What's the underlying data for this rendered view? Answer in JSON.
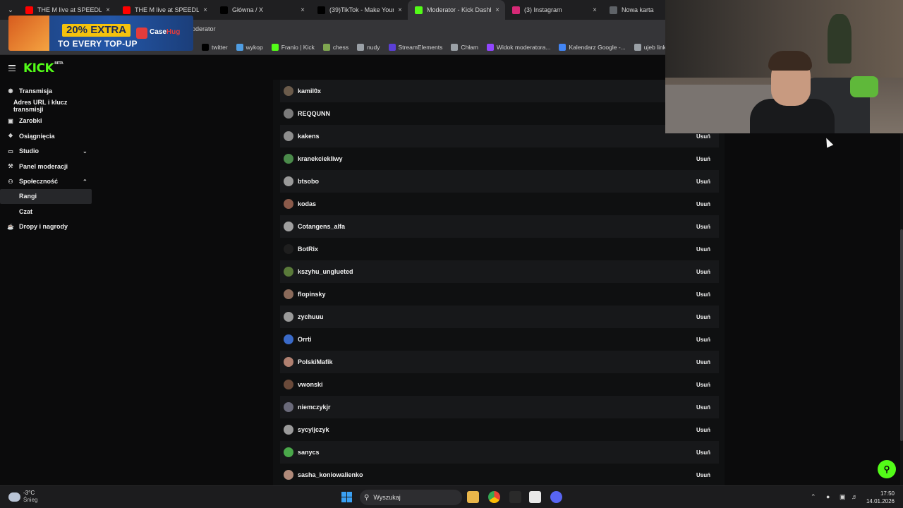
{
  "browser": {
    "tabs": [
      {
        "title": "THE M live at SPEEDLAND",
        "icon": "youtube-icon",
        "color": "#ff0000"
      },
      {
        "title": "THE M live at SPEEDLAND",
        "icon": "youtube-icon",
        "color": "#ff0000"
      },
      {
        "title": "Główna / X",
        "icon": "x-icon",
        "color": "#000000"
      },
      {
        "title": "(39)TikTok - Make Your Day",
        "icon": "tiktok-icon",
        "color": "#000000"
      },
      {
        "title": "Moderator - Kick Dashboard",
        "icon": "kick-icon",
        "color": "#53fc18",
        "active": true
      },
      {
        "title": "(3) Instagram",
        "icon": "instagram-icon",
        "color": "#d62976"
      },
      {
        "title": "Nowa karta",
        "icon": "chrome-icon",
        "color": "#5f6368"
      }
    ],
    "url_fragment": "oderator",
    "bookmarks": [
      {
        "label": "twitter",
        "icon": "x-icon"
      },
      {
        "label": "wykop",
        "icon": "wykop-icon"
      },
      {
        "label": "Franio | Kick",
        "icon": "kick-icon"
      },
      {
        "label": "chess",
        "icon": "chess-icon"
      },
      {
        "label": "nudy",
        "icon": "folder-icon"
      },
      {
        "label": "StreamElements",
        "icon": "streamelements-icon"
      },
      {
        "label": "Chłam",
        "icon": "globe-icon"
      },
      {
        "label": "Widok moderatora...",
        "icon": "twitch-icon"
      },
      {
        "label": "Kalendarz Google -...",
        "icon": "calendar-icon"
      },
      {
        "label": "ujeb link",
        "icon": "globe-icon"
      }
    ]
  },
  "promo": {
    "line1": "20% EXTRA",
    "line2": "TO EVERY TOP-UP",
    "brand_a": "Case",
    "brand_b": "Hug"
  },
  "kick": {
    "logo": "KICK",
    "logo_badge": "BETA",
    "accent": "#53fc18"
  },
  "sidebar": {
    "items": [
      {
        "label": "Transmisja",
        "icon": "broadcast-icon"
      },
      {
        "label": "Adres URL i klucz transmisji"
      },
      {
        "label": "Zarobki",
        "icon": "wallet-icon"
      },
      {
        "label": "Osiągnięcia",
        "icon": "trophy-icon"
      },
      {
        "label": "Studio",
        "icon": "studio-icon",
        "chevron": "chevron-down-icon"
      },
      {
        "label": "Panel moderacji",
        "icon": "wrench-icon"
      },
      {
        "label": "Społeczność",
        "icon": "community-icon",
        "chevron": "chevron-up-icon"
      },
      {
        "label": "Rangi",
        "active": true
      },
      {
        "label": "Czat"
      },
      {
        "label": "Dropy i nagrody",
        "icon": "gift-icon"
      }
    ]
  },
  "moderators": {
    "remove_label": "Usuń",
    "rows": [
      {
        "name": "kamil0x",
        "avatar_color": "#6b5b4b"
      },
      {
        "name": "REQQUNN",
        "avatar_color": "#7a7a7a"
      },
      {
        "name": "kakens",
        "avatar_color": "#8e8e8e"
      },
      {
        "name": "kranekciekliwy",
        "avatar_color": "#4a8a4a"
      },
      {
        "name": "btsobo",
        "avatar_color": "#9a9a9a"
      },
      {
        "name": "kodas",
        "avatar_color": "#8a5a4a"
      },
      {
        "name": "Cotangens_alfa",
        "avatar_color": "#a0a0a0"
      },
      {
        "name": "BotRix",
        "avatar_color": "#1e1e1e"
      },
      {
        "name": "kszyhu_unglueted",
        "avatar_color": "#5a7a3a"
      },
      {
        "name": "flopinsky",
        "avatar_color": "#8a6a5a"
      },
      {
        "name": "zychuuu",
        "avatar_color": "#9a9a9a"
      },
      {
        "name": "Orrti",
        "avatar_color": "#3a6ac8"
      },
      {
        "name": "PolskiMafik",
        "avatar_color": "#b08070"
      },
      {
        "name": "vwonski",
        "avatar_color": "#6a4a3a"
      },
      {
        "name": "niemczykjr",
        "avatar_color": "#6a6a7a"
      },
      {
        "name": "sycyljczyk",
        "avatar_color": "#9a9a9a"
      },
      {
        "name": "sanycs",
        "avatar_color": "#4aa84a"
      },
      {
        "name": "sasha_koniowalienko",
        "avatar_color": "#b08a7a"
      }
    ]
  },
  "taskbar": {
    "weather_temp": "-3°C",
    "weather_cond": "Śnieg",
    "search_placeholder": "Wyszukaj",
    "time": "17:50",
    "date": "14.01.2026"
  }
}
